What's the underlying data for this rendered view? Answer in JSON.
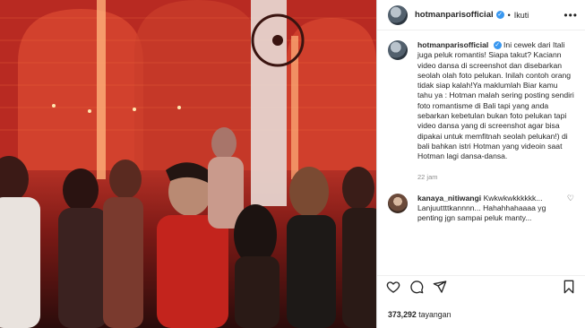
{
  "header": {
    "username": "hotmanparisofficial",
    "separator": "•",
    "follow_label": "Ikuti",
    "more_icon": "more-horizontal-icon"
  },
  "caption": {
    "username": "hotmanparisofficial",
    "text": "Ini cewek dari Itali juga peluk romantis! Siapa takut? Kaciann video dansa di screenshot dan disebarkan seolah olah foto pelukan. Inilah contoh orang tidak siap kalah!Ya maklumlah Biar kamu tahu ya : Hotman malah sering posting sendiri foto romantisme di Bali tapi yang anda sebarkan kebetulan bukan foto pelukan tapi video dansa yang di screenshot agar bisa dipakai untuk memfitnah seolah pelukan!) di bali bahkan istri Hotman yang videoin saat Hotman lagi dansa-dansa.",
    "time": "22 jam"
  },
  "comment": {
    "username": "kanaya_nitiwangi",
    "text": "Kwkwkwkkkkkk... Lanjuuttttkannnn... Hahahhahaaaa yg penting jgn sampai peluk manty..."
  },
  "actions": {
    "icons": [
      "heart-icon",
      "comment-icon",
      "share-icon",
      "bookmark-icon"
    ]
  },
  "views": {
    "count": "373,292",
    "label": "tayangan"
  },
  "colors": {
    "verified": "#3897f0",
    "secondary_text": "#8e8e8e",
    "border": "#dbdbdb"
  }
}
